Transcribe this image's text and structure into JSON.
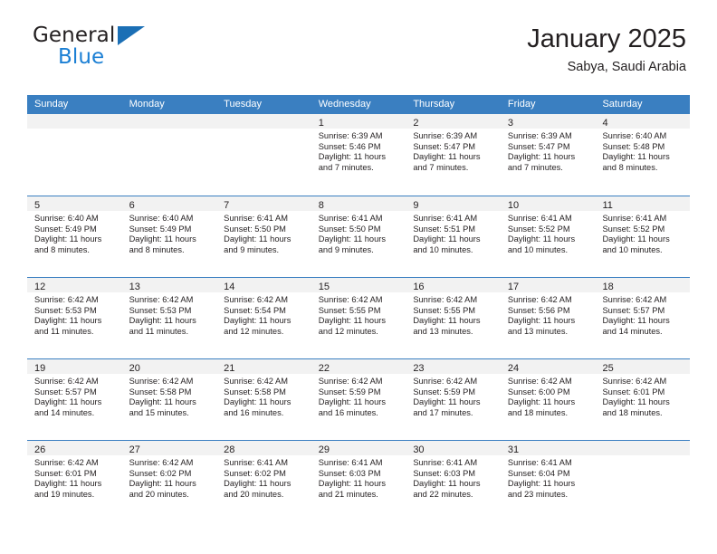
{
  "brand": {
    "name_part1": "General",
    "name_part2": "Blue",
    "logo_icon": "triangle-logo-icon"
  },
  "header": {
    "month_title": "January 2025",
    "location": "Sabya, Saudi Arabia"
  },
  "calendar": {
    "weekdays": [
      "Sunday",
      "Monday",
      "Tuesday",
      "Wednesday",
      "Thursday",
      "Friday",
      "Saturday"
    ],
    "accent_color": "#3a7fc1",
    "day_strip_color": "#f2f2f2",
    "weeks": [
      [
        {
          "day": "",
          "empty": true
        },
        {
          "day": "",
          "empty": true
        },
        {
          "day": "",
          "empty": true
        },
        {
          "day": "1",
          "sunrise": "Sunrise: 6:39 AM",
          "sunset": "Sunset: 5:46 PM",
          "daylight": "Daylight: 11 hours and 7 minutes."
        },
        {
          "day": "2",
          "sunrise": "Sunrise: 6:39 AM",
          "sunset": "Sunset: 5:47 PM",
          "daylight": "Daylight: 11 hours and 7 minutes."
        },
        {
          "day": "3",
          "sunrise": "Sunrise: 6:39 AM",
          "sunset": "Sunset: 5:47 PM",
          "daylight": "Daylight: 11 hours and 7 minutes."
        },
        {
          "day": "4",
          "sunrise": "Sunrise: 6:40 AM",
          "sunset": "Sunset: 5:48 PM",
          "daylight": "Daylight: 11 hours and 8 minutes."
        }
      ],
      [
        {
          "day": "5",
          "sunrise": "Sunrise: 6:40 AM",
          "sunset": "Sunset: 5:49 PM",
          "daylight": "Daylight: 11 hours and 8 minutes."
        },
        {
          "day": "6",
          "sunrise": "Sunrise: 6:40 AM",
          "sunset": "Sunset: 5:49 PM",
          "daylight": "Daylight: 11 hours and 8 minutes."
        },
        {
          "day": "7",
          "sunrise": "Sunrise: 6:41 AM",
          "sunset": "Sunset: 5:50 PM",
          "daylight": "Daylight: 11 hours and 9 minutes."
        },
        {
          "day": "8",
          "sunrise": "Sunrise: 6:41 AM",
          "sunset": "Sunset: 5:50 PM",
          "daylight": "Daylight: 11 hours and 9 minutes."
        },
        {
          "day": "9",
          "sunrise": "Sunrise: 6:41 AM",
          "sunset": "Sunset: 5:51 PM",
          "daylight": "Daylight: 11 hours and 10 minutes."
        },
        {
          "day": "10",
          "sunrise": "Sunrise: 6:41 AM",
          "sunset": "Sunset: 5:52 PM",
          "daylight": "Daylight: 11 hours and 10 minutes."
        },
        {
          "day": "11",
          "sunrise": "Sunrise: 6:41 AM",
          "sunset": "Sunset: 5:52 PM",
          "daylight": "Daylight: 11 hours and 10 minutes."
        }
      ],
      [
        {
          "day": "12",
          "sunrise": "Sunrise: 6:42 AM",
          "sunset": "Sunset: 5:53 PM",
          "daylight": "Daylight: 11 hours and 11 minutes."
        },
        {
          "day": "13",
          "sunrise": "Sunrise: 6:42 AM",
          "sunset": "Sunset: 5:53 PM",
          "daylight": "Daylight: 11 hours and 11 minutes."
        },
        {
          "day": "14",
          "sunrise": "Sunrise: 6:42 AM",
          "sunset": "Sunset: 5:54 PM",
          "daylight": "Daylight: 11 hours and 12 minutes."
        },
        {
          "day": "15",
          "sunrise": "Sunrise: 6:42 AM",
          "sunset": "Sunset: 5:55 PM",
          "daylight": "Daylight: 11 hours and 12 minutes."
        },
        {
          "day": "16",
          "sunrise": "Sunrise: 6:42 AM",
          "sunset": "Sunset: 5:55 PM",
          "daylight": "Daylight: 11 hours and 13 minutes."
        },
        {
          "day": "17",
          "sunrise": "Sunrise: 6:42 AM",
          "sunset": "Sunset: 5:56 PM",
          "daylight": "Daylight: 11 hours and 13 minutes."
        },
        {
          "day": "18",
          "sunrise": "Sunrise: 6:42 AM",
          "sunset": "Sunset: 5:57 PM",
          "daylight": "Daylight: 11 hours and 14 minutes."
        }
      ],
      [
        {
          "day": "19",
          "sunrise": "Sunrise: 6:42 AM",
          "sunset": "Sunset: 5:57 PM",
          "daylight": "Daylight: 11 hours and 14 minutes."
        },
        {
          "day": "20",
          "sunrise": "Sunrise: 6:42 AM",
          "sunset": "Sunset: 5:58 PM",
          "daylight": "Daylight: 11 hours and 15 minutes."
        },
        {
          "day": "21",
          "sunrise": "Sunrise: 6:42 AM",
          "sunset": "Sunset: 5:58 PM",
          "daylight": "Daylight: 11 hours and 16 minutes."
        },
        {
          "day": "22",
          "sunrise": "Sunrise: 6:42 AM",
          "sunset": "Sunset: 5:59 PM",
          "daylight": "Daylight: 11 hours and 16 minutes."
        },
        {
          "day": "23",
          "sunrise": "Sunrise: 6:42 AM",
          "sunset": "Sunset: 5:59 PM",
          "daylight": "Daylight: 11 hours and 17 minutes."
        },
        {
          "day": "24",
          "sunrise": "Sunrise: 6:42 AM",
          "sunset": "Sunset: 6:00 PM",
          "daylight": "Daylight: 11 hours and 18 minutes."
        },
        {
          "day": "25",
          "sunrise": "Sunrise: 6:42 AM",
          "sunset": "Sunset: 6:01 PM",
          "daylight": "Daylight: 11 hours and 18 minutes."
        }
      ],
      [
        {
          "day": "26",
          "sunrise": "Sunrise: 6:42 AM",
          "sunset": "Sunset: 6:01 PM",
          "daylight": "Daylight: 11 hours and 19 minutes."
        },
        {
          "day": "27",
          "sunrise": "Sunrise: 6:42 AM",
          "sunset": "Sunset: 6:02 PM",
          "daylight": "Daylight: 11 hours and 20 minutes."
        },
        {
          "day": "28",
          "sunrise": "Sunrise: 6:41 AM",
          "sunset": "Sunset: 6:02 PM",
          "daylight": "Daylight: 11 hours and 20 minutes."
        },
        {
          "day": "29",
          "sunrise": "Sunrise: 6:41 AM",
          "sunset": "Sunset: 6:03 PM",
          "daylight": "Daylight: 11 hours and 21 minutes."
        },
        {
          "day": "30",
          "sunrise": "Sunrise: 6:41 AM",
          "sunset": "Sunset: 6:03 PM",
          "daylight": "Daylight: 11 hours and 22 minutes."
        },
        {
          "day": "31",
          "sunrise": "Sunrise: 6:41 AM",
          "sunset": "Sunset: 6:04 PM",
          "daylight": "Daylight: 11 hours and 23 minutes."
        },
        {
          "day": "",
          "empty": true
        }
      ]
    ]
  }
}
